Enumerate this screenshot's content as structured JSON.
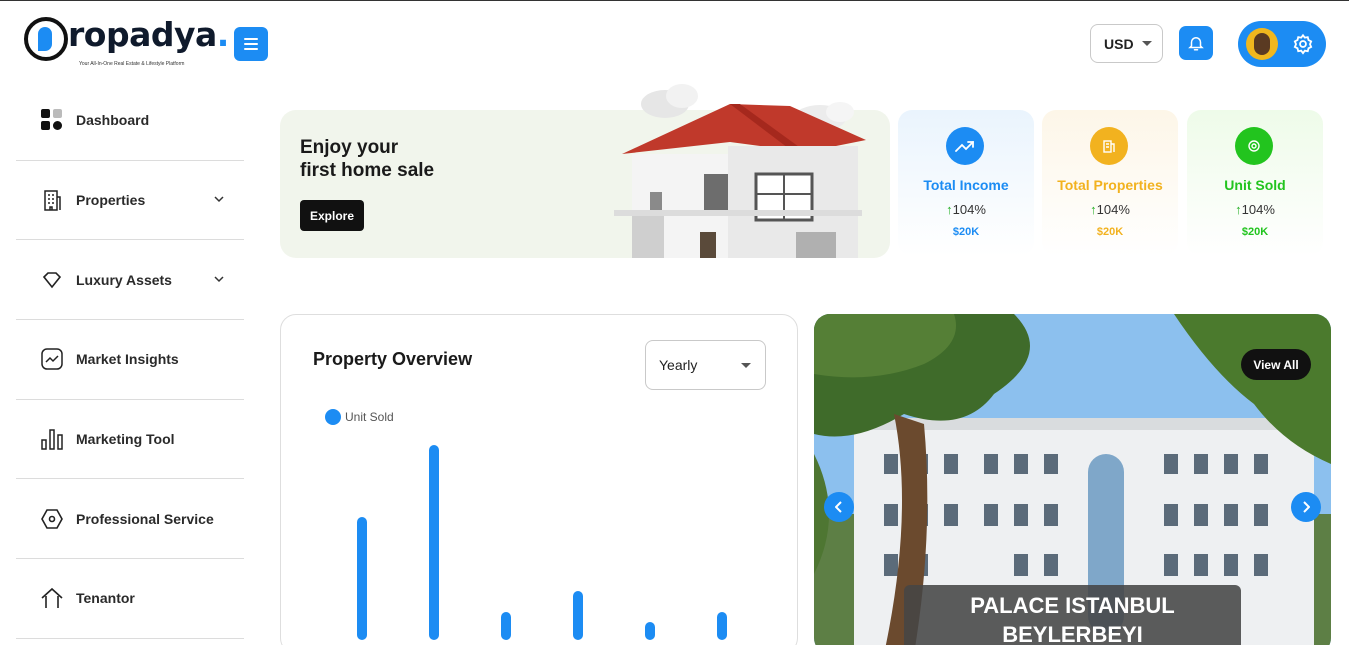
{
  "header": {
    "logo_text": "ropadya",
    "logo_dot": ".",
    "tagline": "Your All-In-One Real Estate & Lifestyle Platform",
    "currency": "USD"
  },
  "sidebar": {
    "items": [
      {
        "label": "Dashboard",
        "icon": "dashboard-icon",
        "has_chevron": false
      },
      {
        "label": "Properties",
        "icon": "building-icon",
        "has_chevron": true
      },
      {
        "label": "Luxury Assets",
        "icon": "diamond-icon",
        "has_chevron": true
      },
      {
        "label": "Market Insights",
        "icon": "chart-icon",
        "has_chevron": false
      },
      {
        "label": "Marketing Tool",
        "icon": "bars-icon",
        "has_chevron": false
      },
      {
        "label": "Professional Service",
        "icon": "hexagon-icon",
        "has_chevron": false
      },
      {
        "label": "Tenantor",
        "icon": "house-icon",
        "has_chevron": false
      }
    ]
  },
  "banner": {
    "title_line1": "Enjoy your",
    "title_line2": "first home sale",
    "button": "Explore"
  },
  "stats": [
    {
      "title": "Total Income",
      "percent": "104%",
      "amount": "$20K",
      "color": "#1c8cf3",
      "bg": "#eaf4fd",
      "icon": "trend-up-icon"
    },
    {
      "title": "Total Properties",
      "percent": "104%",
      "amount": "$20K",
      "color": "#f2b21f",
      "bg": "#fdf6e8",
      "icon": "building-icon"
    },
    {
      "title": "Unit Sold",
      "percent": "104%",
      "amount": "$20K",
      "color": "#22c41e",
      "bg": "#eefbe9",
      "icon": "badge-icon"
    }
  ],
  "overview": {
    "title": "Property Overview",
    "period": "Yearly",
    "legend": "Unit Sold"
  },
  "chart_data": {
    "type": "bar",
    "series": [
      {
        "name": "Unit Sold",
        "values": [
          123,
          195,
          28,
          49,
          18,
          28
        ]
      }
    ],
    "color": "#1c8cf3",
    "grid": false
  },
  "featured": {
    "view_all": "View All",
    "caption_line1": "PALACE ISTANBUL",
    "caption_line2": "BEYLERBEYI"
  },
  "colors": {
    "accent": "#1c8cf3",
    "dark": "#111111"
  }
}
